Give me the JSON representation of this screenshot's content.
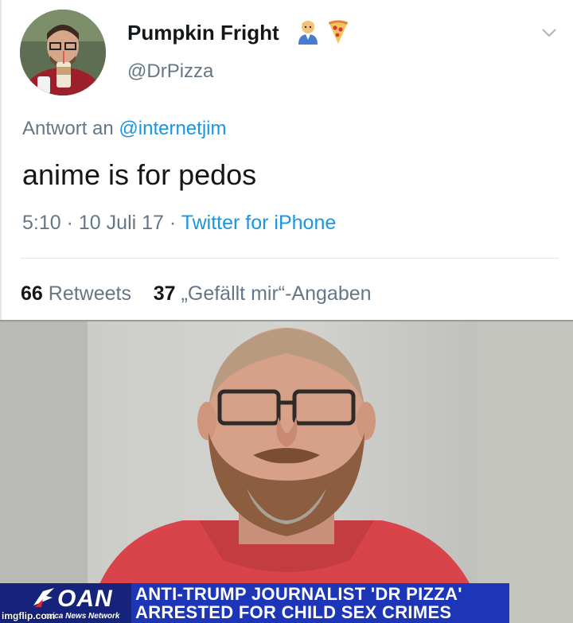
{
  "tweet": {
    "display_name": "Pumpkin Fright",
    "name_emojis": [
      "person-emoji",
      "pizza-emoji"
    ],
    "handle": "@DrPizza",
    "reply_prefix": "Antwort an ",
    "reply_mention": "@internetjim",
    "text": "anime is for pedos",
    "time": "5:10",
    "date": "10 Juli 17",
    "separator": "·",
    "source": "Twitter for iPhone",
    "retweets_count": "66",
    "retweets_label": "Retweets",
    "likes_count": "37",
    "likes_label": "„Gefällt mir“-Angaben",
    "link_color": "#1b95e0"
  },
  "news": {
    "network_logo": "OAN",
    "network_sub": "erica News Network",
    "headline_line1": "ANTI-TRUMP JOURNALIST 'DR PIZZA'",
    "headline_line2": "ARRESTED FOR CHILD SEX CRIMES",
    "bar_color": "#1d36b8"
  },
  "watermark": "imgflip.com"
}
